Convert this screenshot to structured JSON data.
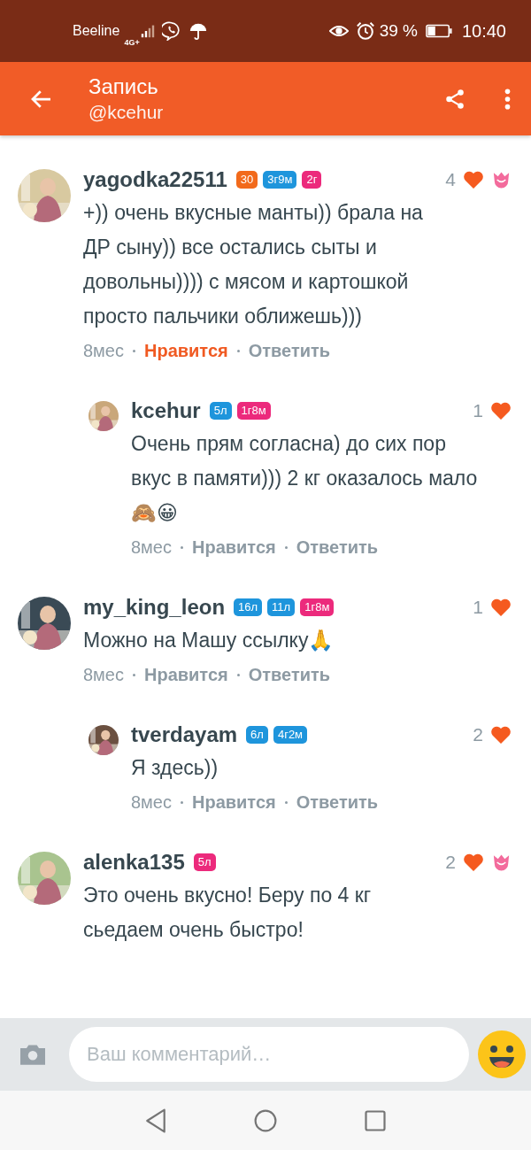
{
  "status_bar": {
    "carrier": "Beeline",
    "network": "4G+",
    "battery": "39 %",
    "time": "10:40"
  },
  "header": {
    "title": "Запись",
    "subtitle": "@kcehur"
  },
  "comments": [
    {
      "username": "yagodka22511",
      "badges": [
        {
          "text": "30",
          "color": "#f26a1b"
        },
        {
          "text": "3г9м",
          "color": "#1e95dc"
        },
        {
          "text": "2г",
          "color": "#ec2a7c"
        }
      ],
      "likes": "4",
      "gift": true,
      "text": "+)) очень вкусные манты)) брала на ДР сыну)) все остались сыты и довольны)))) с мясом и картошкой просто пальчики оближешь)))",
      "time": "8мес",
      "like_label": "Нравится",
      "liked": true,
      "reply_label": "Ответить",
      "children": [
        {
          "username": "kcehur",
          "badges": [
            {
              "text": "5л",
              "color": "#1e95dc"
            },
            {
              "text": "1г8м",
              "color": "#ec2a7c"
            }
          ],
          "likes": "1",
          "gift": false,
          "text": "Очень прям согласна) до сих пор вкус в памяти))) 2 кг оказалось мало 🙈😀",
          "time": "8мес",
          "like_label": "Нравится",
          "liked": false,
          "reply_label": "Ответить"
        }
      ]
    },
    {
      "username": "my_king_leon",
      "badges": [
        {
          "text": "16л",
          "color": "#1e95dc"
        },
        {
          "text": "11л",
          "color": "#1e95dc"
        },
        {
          "text": "1г8м",
          "color": "#ec2a7c"
        }
      ],
      "likes": "1",
      "gift": false,
      "text": "Можно на Машу ссылку🙏",
      "time": "8мес",
      "like_label": "Нравится",
      "liked": false,
      "reply_label": "Ответить",
      "children": [
        {
          "username": "tverdayam",
          "badges": [
            {
              "text": "6л",
              "color": "#1e95dc"
            },
            {
              "text": "4г2м",
              "color": "#1e95dc"
            }
          ],
          "likes": "2",
          "gift": false,
          "text": "Я здесь))",
          "time": "8мес",
          "like_label": "Нравится",
          "liked": false,
          "reply_label": "Ответить"
        }
      ]
    },
    {
      "username": "alenka135",
      "badges": [
        {
          "text": "5л",
          "color": "#ec2a7c"
        }
      ],
      "likes": "2",
      "gift": true,
      "text": "Это очень вкусно! Беру по 4 кг сьедаем очень быстро!"
    }
  ],
  "composer": {
    "placeholder": "Ваш комментарий…"
  }
}
